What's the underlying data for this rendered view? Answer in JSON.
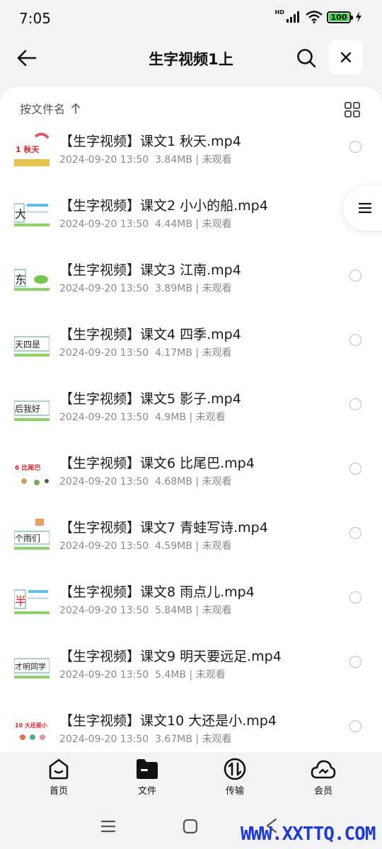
{
  "status_bar": {
    "time": "7:05",
    "network": "HD",
    "battery": "100"
  },
  "header": {
    "title": "生字视频1上"
  },
  "sort": {
    "label": "按文件名"
  },
  "files": [
    {
      "name": "【生字视频】课文1 秋天.mp4",
      "date": "2024-09-20 13:50",
      "size": "3.84MB",
      "status": "未观看",
      "thumb_text": "1 秋天"
    },
    {
      "name": "【生字视频】课文2 小小的船.mp4",
      "date": "2024-09-20 13:50",
      "size": "4.44MB",
      "status": "未观看",
      "thumb_text": "大"
    },
    {
      "name": "【生字视频】课文3 江南.mp4",
      "date": "2024-09-20 13:50",
      "size": "3.89MB",
      "status": "未观看",
      "thumb_text": "东"
    },
    {
      "name": "【生字视频】课文4 四季.mp4",
      "date": "2024-09-20 13:50",
      "size": "4.17MB",
      "status": "未观看",
      "thumb_text": "天四是"
    },
    {
      "name": "【生字视频】课文5 影子.mp4",
      "date": "2024-09-20 13:50",
      "size": "4.9MB",
      "status": "未观看",
      "thumb_text": "后我好"
    },
    {
      "name": "【生字视频】课文6 比尾巴.mp4",
      "date": "2024-09-20 13:50",
      "size": "4.68MB",
      "status": "未观看",
      "thumb_text": "6 比尾巴"
    },
    {
      "name": "【生字视频】课文7 青蛙写诗.mp4",
      "date": "2024-09-20 13:50",
      "size": "4.59MB",
      "status": "未观看",
      "thumb_text": "个雨们"
    },
    {
      "name": "【生字视频】课文8 雨点儿.mp4",
      "date": "2024-09-20 13:50",
      "size": "5.84MB",
      "status": "未观看",
      "thumb_text": "半"
    },
    {
      "name": "【生字视频】课文9 明天要远足.mp4",
      "date": "2024-09-20 13:50",
      "size": "5.4MB",
      "status": "未观看",
      "thumb_text": "才明同学"
    },
    {
      "name": "【生字视频】课文10 大还是小.mp4",
      "date": "2024-09-20 13:50",
      "size": "3.67MB",
      "status": "未观看",
      "thumb_text": "10 大还是小"
    }
  ],
  "bottom_nav": [
    {
      "label": "首页",
      "icon": "home-icon"
    },
    {
      "label": "文件",
      "icon": "folder-icon"
    },
    {
      "label": "传输",
      "icon": "transfer-icon"
    },
    {
      "label": "会员",
      "icon": "cloud-icon"
    }
  ],
  "watermark": "WWW.XXTTQ.COM",
  "colors": {
    "accent_green": "#3fd14a",
    "watermark_blue": "#1f3ad8"
  }
}
